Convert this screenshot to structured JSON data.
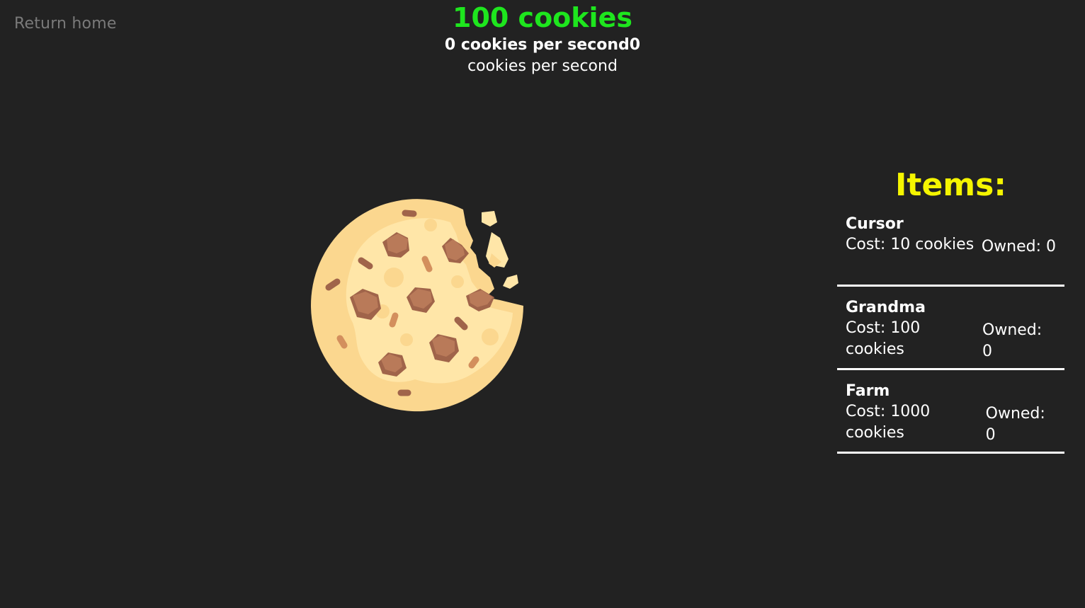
{
  "nav": {
    "return_home": "Return home"
  },
  "stats": {
    "cookie_count": "100 cookies",
    "cps_bold": "0 cookies per second",
    "cps_bold_value": "0",
    "cps_rest": " cookies per second"
  },
  "items": {
    "title": "Items:",
    "list": [
      {
        "name": "Cursor",
        "cost": "Cost: 10 cookies",
        "owned": "Owned: 0"
      },
      {
        "name": "Grandma",
        "cost": "Cost: 100 cookies",
        "owned": "Owned: 0"
      },
      {
        "name": "Farm",
        "cost": "Cost: 1000 cookies",
        "owned": "Owned: 0"
      }
    ]
  },
  "colors": {
    "background": "#222222",
    "cookie_count": "#1ee61e",
    "items_title": "#f5f500",
    "muted_text": "#7a7a7a"
  },
  "icons": {
    "cookie": "cookie-icon"
  }
}
